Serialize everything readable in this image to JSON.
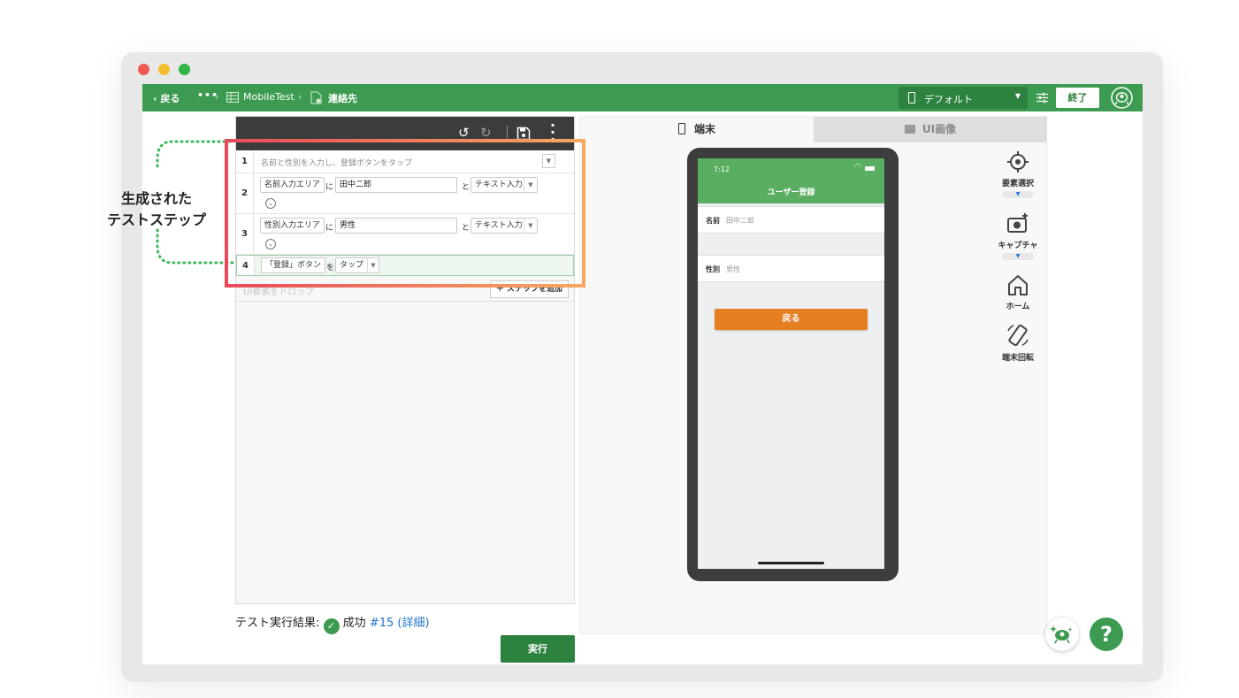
{
  "topbar": {
    "back_label": "戻る",
    "more_label": "•••",
    "crumb_project": "MobileTest",
    "crumb_test": "連絡先",
    "device_label": "デフォルト",
    "end_label": "終了"
  },
  "steps": [
    {
      "num": "1",
      "description": "名前と性別を入力し、登録ボタンをタップ"
    },
    {
      "num": "2",
      "target": "名前入力エリア",
      "particle": "に",
      "value": "田中二郎",
      "joiner": "と",
      "action": "テキスト入力"
    },
    {
      "num": "3",
      "target": "性別入力エリア",
      "particle": "に",
      "value": "男性",
      "joiner": "と",
      "action": "テキスト入力"
    },
    {
      "num": "4",
      "target": "「登録」ボタン",
      "particle": "を",
      "action": "タップ"
    }
  ],
  "drop": {
    "placeholder": "UI要素をドロップ",
    "add_label": "＋ ステップを追加"
  },
  "annotation": {
    "line1": "生成された",
    "line2": "テストステップ"
  },
  "result": {
    "label": "テスト実行結果:",
    "status": "成功",
    "run_id": "#15",
    "detail": "(詳細)"
  },
  "run_label": "実行",
  "tabs": {
    "device": "端末",
    "ui_image": "UI画像"
  },
  "phone": {
    "time": "7:12",
    "title": "ユーザー登録",
    "name_label": "名前",
    "name_value": "田中二郎",
    "gender_label": "性別",
    "gender_value": "男性",
    "back_button": "戻る"
  },
  "tools": {
    "select_element": "要素選択",
    "capture": "キャプチャ",
    "home": "ホーム",
    "rotate": "端末回転"
  },
  "help_label": "?",
  "colors": {
    "brand_green": "#3c9b50",
    "dark_green": "#2e8240",
    "accent_orange": "#e67e22",
    "highlight_start": "#e94a5a",
    "highlight_end": "#f6a860"
  }
}
